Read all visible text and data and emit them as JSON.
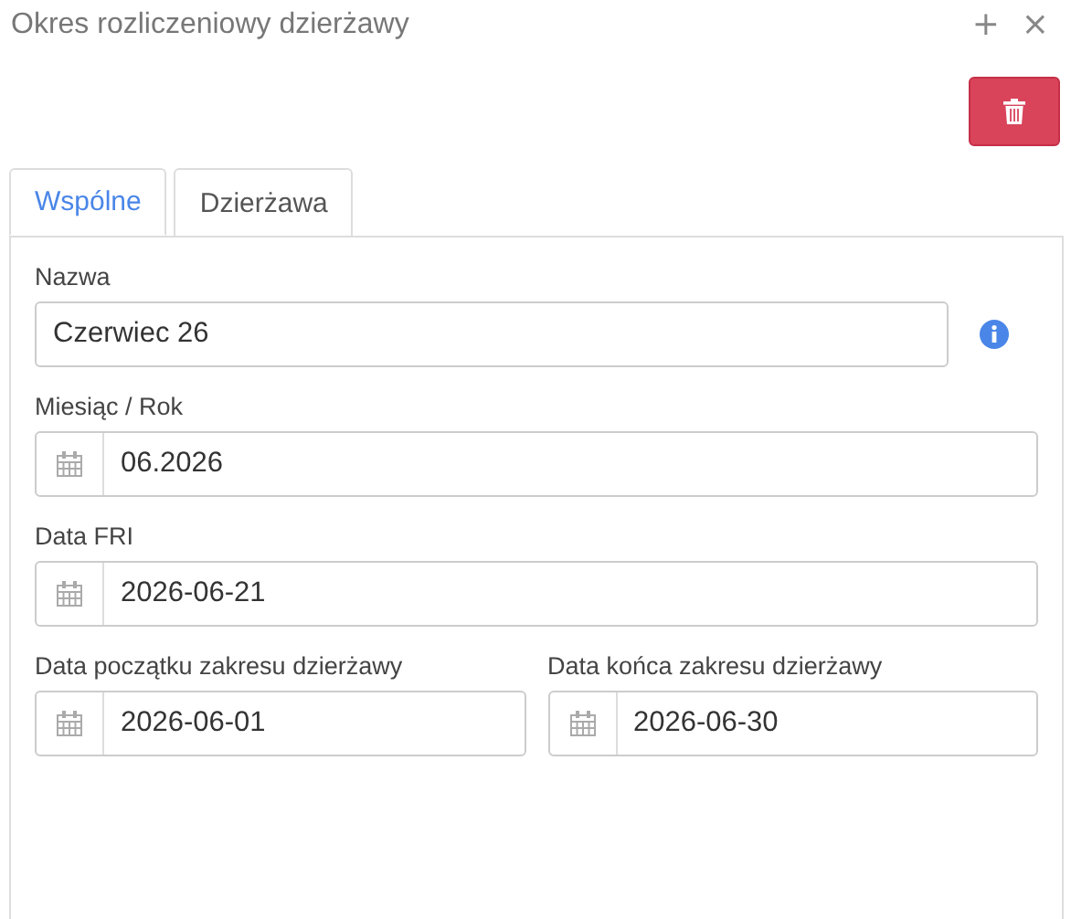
{
  "window": {
    "title": "Okres rozliczeniowy dzierżawy",
    "controls": [
      "+",
      "×"
    ]
  },
  "tabs": [
    {
      "label": "Wspólne",
      "selected": true
    },
    {
      "label": "Dzierżawa",
      "selected": false
    }
  ],
  "rows": [
    {
      "fields": [
        {
          "label": "Nazwa",
          "value": "Czerwiec 26",
          "kind": "text",
          "info": true
        }
      ]
    },
    {
      "fields": [
        {
          "label": "Miesiąc / Rok",
          "value": "06.2026",
          "kind": "date",
          "info": false
        }
      ]
    },
    {
      "fields": [
        {
          "label": "Data FRI",
          "value": "2026-06-21",
          "kind": "date",
          "info": false
        }
      ]
    },
    {
      "fields": [
        {
          "label": "Data początku zakresu dzierżawy",
          "value": "2026-06-01",
          "kind": "date",
          "info": false
        },
        {
          "label": "Data końca zakresu dzierżawy",
          "value": "2026-06-30",
          "kind": "date",
          "info": false
        }
      ]
    }
  ]
}
